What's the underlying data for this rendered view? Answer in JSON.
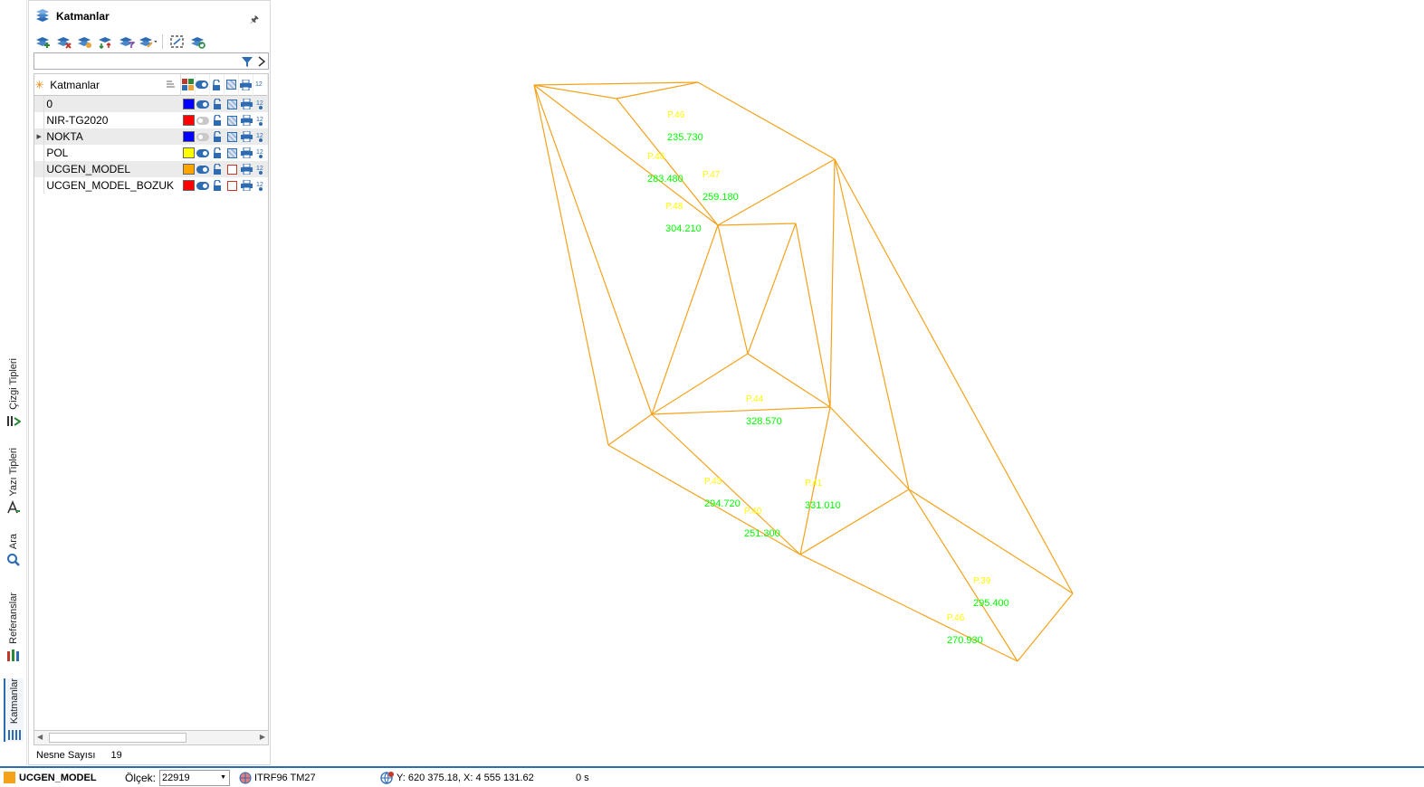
{
  "panel": {
    "title": "Katmanlar",
    "column_header": "Katmanlar",
    "count_label": "Nesne Sayısı",
    "count_value": "19"
  },
  "side_tabs": [
    "Çizgi Tipleri",
    "Yazı Tipleri",
    "Ara",
    "Referanslar",
    "Katmanlar"
  ],
  "layers": [
    {
      "name": "0",
      "color": "#0000ff",
      "visible": true,
      "fill": true
    },
    {
      "name": "NIR-TG2020",
      "color": "#ff0000",
      "visible": false,
      "fill": true
    },
    {
      "name": "NOKTA",
      "color": "#0000ff",
      "visible": false,
      "fill": true,
      "current": true
    },
    {
      "name": "POL",
      "color": "#ffff00",
      "visible": true,
      "fill": true
    },
    {
      "name": "UCGEN_MODEL",
      "color": "#ffa500",
      "visible": true,
      "fill": false
    },
    {
      "name": "UCGEN_MODEL_BOZUK",
      "color": "#ff0000",
      "visible": true,
      "fill": false
    }
  ],
  "canvas": {
    "line_color": "#f5a21b",
    "point_label_color": "#ffff00",
    "elevation_color": "#00ff00",
    "points": [
      {
        "id": "P.46",
        "elev": "235.730"
      },
      {
        "id": "P.48",
        "elev": "283.480"
      },
      {
        "id": "P.47",
        "elev": "259.180"
      },
      {
        "id": "P.48",
        "elev": "304.210"
      },
      {
        "id": "P.44",
        "elev": "328.570"
      },
      {
        "id": "P.43",
        "elev": "294.720"
      },
      {
        "id": "P.40",
        "elev": "251.300"
      },
      {
        "id": "P.41",
        "elev": "331.010"
      },
      {
        "id": "P.39",
        "elev": "295.400"
      },
      {
        "id": "P.46",
        "elev": "270.930"
      }
    ]
  },
  "statusbar": {
    "layer": "UCGEN_MODEL",
    "scale_label": "Ölçek:",
    "scale_value": "22919",
    "crs": "ITRF96 TM27",
    "coords": "Y: 620 375.18, X: 4 555 131.62",
    "time": "0 s"
  },
  "colors": {
    "accent": "#2d6bb3",
    "layer_current": "#f5a21b"
  }
}
